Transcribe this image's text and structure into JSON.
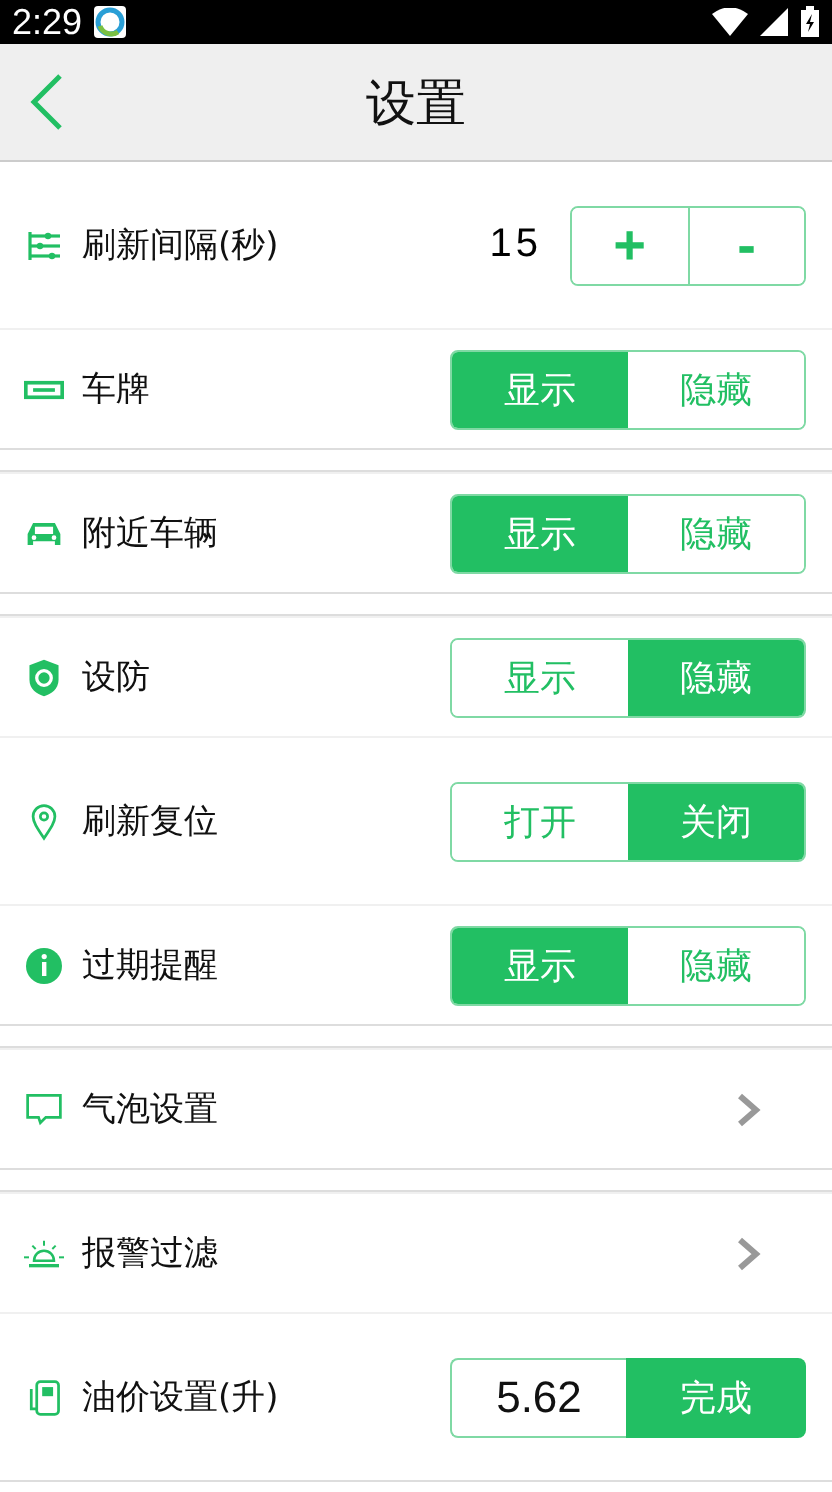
{
  "status_bar": {
    "time": "2:29"
  },
  "header": {
    "title": "设置"
  },
  "groups": [
    {
      "rows": [
        {
          "kind": "stepper",
          "label": "刷新间隔(秒)",
          "value": "15",
          "buttons": [
            "+",
            "-"
          ]
        },
        {
          "kind": "segment",
          "label": "车牌",
          "options": [
            {
              "label": "显示",
              "selected": true
            },
            {
              "label": "隐藏",
              "selected": false
            }
          ]
        }
      ]
    },
    {
      "rows": [
        {
          "kind": "segment",
          "label": "附近车辆",
          "options": [
            {
              "label": "显示",
              "selected": true
            },
            {
              "label": "隐藏",
              "selected": false
            }
          ]
        }
      ]
    },
    {
      "rows": [
        {
          "kind": "segment",
          "label": "设防",
          "options": [
            {
              "label": "显示",
              "selected": false
            },
            {
              "label": "隐藏",
              "selected": true
            }
          ]
        },
        {
          "kind": "segment",
          "label": "刷新复位",
          "options": [
            {
              "label": "打开",
              "selected": false
            },
            {
              "label": "关闭",
              "selected": true
            }
          ]
        },
        {
          "kind": "segment",
          "label": "过期提醒",
          "options": [
            {
              "label": "显示",
              "selected": true
            },
            {
              "label": "隐藏",
              "selected": false
            }
          ]
        }
      ]
    },
    {
      "rows": [
        {
          "kind": "link",
          "label": "气泡设置"
        }
      ]
    },
    {
      "rows": [
        {
          "kind": "link",
          "label": "报警过滤"
        },
        {
          "kind": "input",
          "label": "油价设置(升)",
          "value": "5.62",
          "button": "完成"
        }
      ]
    }
  ]
}
